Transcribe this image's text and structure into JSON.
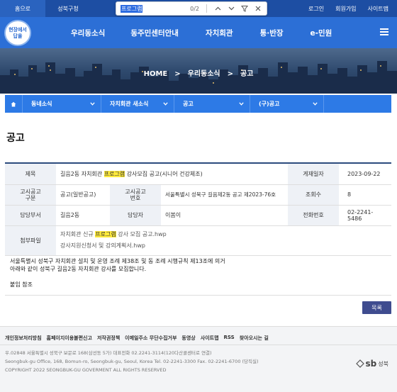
{
  "topbar": {
    "home": "홈으로",
    "office": "성북구청",
    "login": "로그인",
    "join": "회원가입",
    "sitemap": "사이트맵"
  },
  "find": {
    "query": "프로그램",
    "count": "0/2"
  },
  "logo": {
    "line1": "현장에서",
    "line2": "답을"
  },
  "nav": {
    "items": [
      "우리동소식",
      "동주민센터안내",
      "자치회관",
      "통·반장",
      "e-민원"
    ]
  },
  "breadcrumb": {
    "home": "HOME",
    "sep": ">",
    "level1": "우리동소식",
    "level2": "공고"
  },
  "subnav": {
    "items": [
      "동네소식",
      "자치회관 새소식",
      "공고",
      "(구)공고"
    ]
  },
  "page": {
    "title": "공고"
  },
  "post": {
    "title_label": "제목",
    "title_pre": "길음2동 자치회관 ",
    "title_hl": "프로그램",
    "title_post": " 강사모집 공고(시니어 건강체조)",
    "date_label": "게재일자",
    "date": "2023-09-22",
    "type_label_1": "고시공고",
    "type_label_2": "구분",
    "type": "공고(일반공고)",
    "num_label_1": "고시공고",
    "num_label_2": "번호",
    "num": "서울특별시 성북구 길음제2동 공고 제2023-76호",
    "views_label": "조회수",
    "views": "8",
    "dept_label": "담당부서",
    "dept": "길음2동",
    "person_label": "담당자",
    "person": "이봄이",
    "phone_label": "전화번호",
    "phone": "02-2241-5486",
    "attach_label": "첨부파일",
    "file1_pre": "자치회관 신규 ",
    "file1_hl": "프로그램",
    "file1_post": " 강사 모집 공고.hwp",
    "file2": "강사지원신청서 및 강의계획서.hwp",
    "body_1": "서울특별시 성북구 자치회관 설치 및 운영 조례 제38조 및 동 조례 시행규칙 제13조에 의거",
    "body_2": "아래와 같이 성북구 길음2동 자치회관 강사를 모집합니다.",
    "body_3": "붙임 참조",
    "list_button": "목록"
  },
  "footer": {
    "links": [
      "개인정보처리방침",
      "홈페이지이용불편신고",
      "저작권정책",
      "이메일주소 무단수집거부",
      "동영상",
      "사이트맵",
      "RSS",
      "찾아오시는 길"
    ],
    "addr_ko": "우.02848 서울특별시 성북구 보문로 168(삼선동 5가) 대표전화 02.2241-3114(120다산콜센터로 연결)",
    "addr_en": "Seongbuk-gu Office, 168, Bomun-ro, Seongbuk-gu, Seoul, Korea Tel. 02-2241-3300 Fax. 02-2241-6700 (당직실)",
    "copyright": "COPYRIGHT 2022 SEONGBUK-GU GOVERMENT ALL RIGHTS RESERVED",
    "logo_text": "sb",
    "logo_sub": "성북"
  }
}
